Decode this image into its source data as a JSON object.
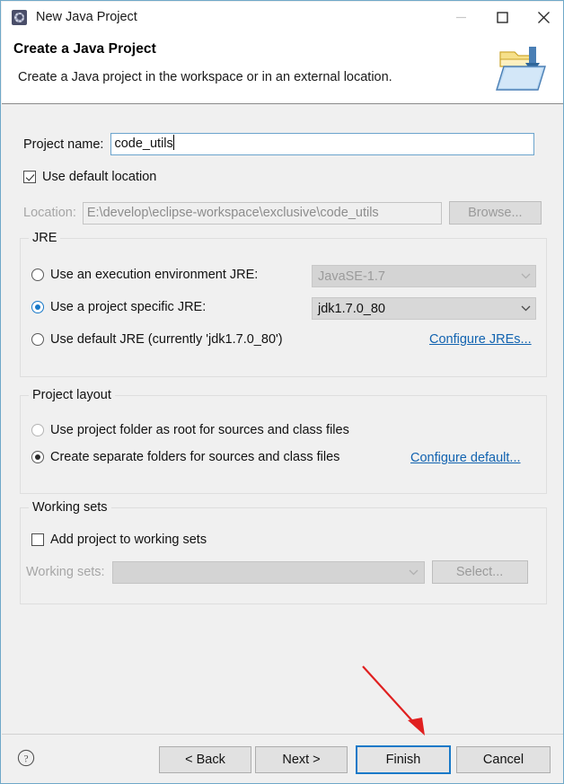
{
  "window": {
    "title": "New Java Project",
    "icon": "eclipse-wizard-icon",
    "controls": {
      "minimize_label": "Minimize",
      "maximize_label": "Maximize",
      "close_label": "Close"
    }
  },
  "banner": {
    "title": "Create a Java Project",
    "subtitle": "Create a Java project in the workspace or in an external location.",
    "icon": "java-project-folder-icon"
  },
  "form": {
    "project_name_label": "Project name:",
    "project_name_value": "code_utils",
    "project_name_placeholder": "",
    "use_default_location_label": "Use default location",
    "use_default_location_checked": true,
    "location_label": "Location:",
    "location_value": "E:\\develop\\eclipse-workspace\\exclusive\\code_utils",
    "browse_label": "Browse..."
  },
  "jre": {
    "group_title": "JRE",
    "options": [
      {
        "label": "Use an execution environment JRE:",
        "selected": false,
        "combo_value": "JavaSE-1.7",
        "combo_enabled": false
      },
      {
        "label": "Use a project specific JRE:",
        "selected": true,
        "combo_value": "jdk1.7.0_80",
        "combo_enabled": true
      },
      {
        "label": "Use default JRE (currently 'jdk1.7.0_80')",
        "selected": false
      }
    ],
    "configure_link": "Configure JREs..."
  },
  "project_layout": {
    "group_title": "Project layout",
    "options": [
      {
        "label": "Use project folder as root for sources and class files",
        "selected": false
      },
      {
        "label": "Create separate folders for sources and class files",
        "selected": true
      }
    ],
    "configure_link": "Configure default..."
  },
  "working_sets": {
    "group_title": "Working sets",
    "add_checkbox_label": "Add project to working sets",
    "add_checkbox_checked": false,
    "working_sets_label": "Working sets:",
    "working_sets_value": "",
    "select_label": "Select..."
  },
  "footer": {
    "help_icon": "help-question-icon",
    "back_label": "< Back",
    "next_label": "Next >",
    "finish_label": "Finish",
    "cancel_label": "Cancel",
    "default_button": "Finish"
  },
  "annotation": {
    "type": "arrow",
    "color": "#e02020",
    "points_to": "finish-button"
  },
  "colors": {
    "accent": "#1879c8",
    "link": "#1263b0",
    "dialog_bg": "#f0f0f0",
    "banner_bg": "#ffffff",
    "annotation_red": "#e02020"
  }
}
